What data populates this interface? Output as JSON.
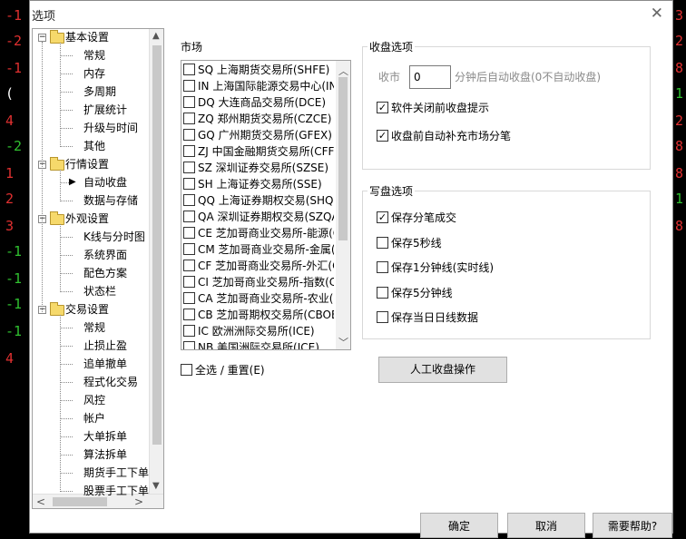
{
  "background": {
    "left_numbers": [
      {
        "text": "-1",
        "color": "#e03030"
      },
      {
        "text": "-2",
        "color": "#e03030"
      },
      {
        "text": "-1",
        "color": "#e03030"
      },
      {
        "text": "(",
        "color": "#ffffff"
      },
      {
        "text": "4",
        "color": "#e03030"
      },
      {
        "text": "-2",
        "color": "#30c030"
      },
      {
        "text": "1",
        "color": "#e03030"
      },
      {
        "text": "2",
        "color": "#e03030"
      },
      {
        "text": "3",
        "color": "#e03030"
      },
      {
        "text": "-1",
        "color": "#30c030"
      },
      {
        "text": "-1",
        "color": "#30c030"
      },
      {
        "text": "-1",
        "color": "#30c030"
      },
      {
        "text": "-1",
        "color": "#30c030"
      },
      {
        "text": "4",
        "color": "#e03030"
      }
    ],
    "right_numbers": [
      {
        "text": "3",
        "color": "#e03030"
      },
      {
        "text": "2",
        "color": "#e03030"
      },
      {
        "text": "8",
        "color": "#e03030"
      },
      {
        "text": "1",
        "color": "#30c030"
      },
      {
        "text": "2",
        "color": "#e03030"
      },
      {
        "text": "8",
        "color": "#e03030"
      },
      {
        "text": "8",
        "color": "#e03030"
      },
      {
        "text": "1",
        "color": "#30c030"
      },
      {
        "text": "8",
        "color": "#e03030"
      }
    ]
  },
  "dialog": {
    "title": "选项"
  },
  "tree": {
    "items": [
      {
        "label": "基本设置",
        "level": 0
      },
      {
        "label": "常规",
        "level": 1
      },
      {
        "label": "内存",
        "level": 1
      },
      {
        "label": "多周期",
        "level": 1
      },
      {
        "label": "扩展统计",
        "level": 1
      },
      {
        "label": "升级与时间",
        "level": 1
      },
      {
        "label": "其他",
        "level": 1
      },
      {
        "label": "行情设置",
        "level": 0
      },
      {
        "label": "自动收盘",
        "level": 1,
        "selected": true
      },
      {
        "label": "数据与存储",
        "level": 1
      },
      {
        "label": "外观设置",
        "level": 0
      },
      {
        "label": "K线与分时图",
        "level": 1
      },
      {
        "label": "系统界面",
        "level": 1
      },
      {
        "label": "配色方案",
        "level": 1
      },
      {
        "label": "状态栏",
        "level": 1
      },
      {
        "label": "交易设置",
        "level": 0
      },
      {
        "label": "常规",
        "level": 1
      },
      {
        "label": "止损止盈",
        "level": 1
      },
      {
        "label": "追单撤单",
        "level": 1
      },
      {
        "label": "程式化交易",
        "level": 1
      },
      {
        "label": "风控",
        "level": 1
      },
      {
        "label": "帐户",
        "level": 1
      },
      {
        "label": "大单拆单",
        "level": 1
      },
      {
        "label": "算法拆单",
        "level": 1
      },
      {
        "label": "期货手工下单",
        "level": 1
      },
      {
        "label": "股票手工下单",
        "level": 1
      }
    ]
  },
  "market": {
    "label": "市场",
    "items": [
      {
        "label": "SQ 上海期货交易所(SHFE)",
        "checked": false
      },
      {
        "label": "IN 上海国际能源交易中心(INE)",
        "checked": false
      },
      {
        "label": "DQ 大连商品交易所(DCE)",
        "checked": false
      },
      {
        "label": "ZQ 郑州期货交易所(CZCE)",
        "checked": false
      },
      {
        "label": "GQ 广州期货交易所(GFEX)",
        "checked": false
      },
      {
        "label": "ZJ 中国金融期货交易所(CFFEX)",
        "checked": false
      },
      {
        "label": "SZ 深圳证券交易所(SZSE)",
        "checked": false
      },
      {
        "label": "SH 上海证券交易所(SSE)",
        "checked": false
      },
      {
        "label": "QQ 上海证券期权交易(SHQO)",
        "checked": false
      },
      {
        "label": "QA 深圳证券期权交易(SZQA)",
        "checked": false
      },
      {
        "label": "CE 芝加哥商业交易所-能源(CME)",
        "checked": false
      },
      {
        "label": "CM 芝加哥商业交易所-金属(CME)",
        "checked": false
      },
      {
        "label": "CF 芝加哥商业交易所-外汇(CME)",
        "checked": false
      },
      {
        "label": "CI 芝加哥商业交易所-指数(CME)",
        "checked": false
      },
      {
        "label": "CA 芝加哥商业交易所-农业(CME)",
        "checked": false
      },
      {
        "label": "CB 芝加哥期权交易所(CBOE)",
        "checked": false
      },
      {
        "label": "IC 欧洲洲际交易所(ICE)",
        "checked": false
      },
      {
        "label": "NB 美国洲际交易所(ICE)",
        "checked": false
      }
    ],
    "select_all_label": "全选 / 重置(E)"
  },
  "close_options": {
    "title": "收盘选项",
    "close_label": "收市",
    "close_value": "0",
    "close_suffix": "分钟后自动收盘(0不自动收盘)",
    "check1": {
      "label": "软件关闭前收盘提示",
      "checked": true
    },
    "check2": {
      "label": "收盘前自动补充市场分笔",
      "checked": true
    }
  },
  "write_options": {
    "title": "写盘选项",
    "items": [
      {
        "label": "保存分笔成交",
        "checked": true
      },
      {
        "label": "保存5秒线",
        "checked": false
      },
      {
        "label": "保存1分钟线(实时线)",
        "checked": false
      },
      {
        "label": "保存5分钟线",
        "checked": false
      },
      {
        "label": "保存当日日线数据",
        "checked": false
      }
    ]
  },
  "manual_close_label": "人工收盘操作",
  "footer": {
    "ok_label": "确定",
    "cancel_label": "取消",
    "help_label": "需要帮助?"
  }
}
